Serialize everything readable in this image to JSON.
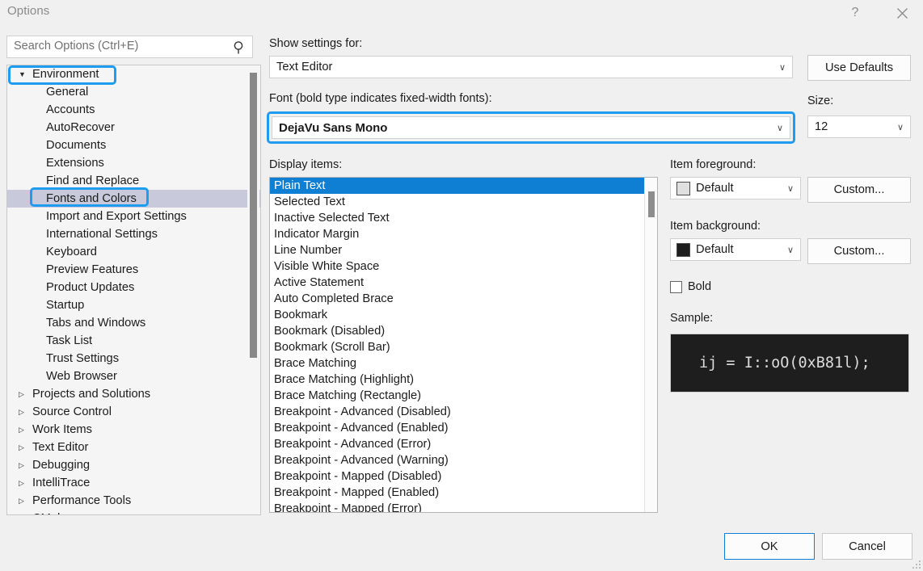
{
  "window": {
    "title": "Options",
    "help_icon": "question-mark-icon",
    "help_glyph": "?",
    "close_icon": "close-icon"
  },
  "search": {
    "placeholder": "Search Options (Ctrl+E)",
    "icon": "search-icon"
  },
  "tree": {
    "scrollbar": "vertical-scrollbar",
    "nodes": [
      {
        "label": "Environment",
        "level": 0,
        "expanded": true,
        "selected": false,
        "arrow": "▼",
        "highlighted": true
      },
      {
        "label": "General",
        "level": 1,
        "expanded": false,
        "selected": false,
        "arrow": "",
        "highlighted": false
      },
      {
        "label": "Accounts",
        "level": 1,
        "expanded": false,
        "selected": false,
        "arrow": "",
        "highlighted": false
      },
      {
        "label": "AutoRecover",
        "level": 1,
        "expanded": false,
        "selected": false,
        "arrow": "",
        "highlighted": false
      },
      {
        "label": "Documents",
        "level": 1,
        "expanded": false,
        "selected": false,
        "arrow": "",
        "highlighted": false
      },
      {
        "label": "Extensions",
        "level": 1,
        "expanded": false,
        "selected": false,
        "arrow": "",
        "highlighted": false
      },
      {
        "label": "Find and Replace",
        "level": 1,
        "expanded": false,
        "selected": false,
        "arrow": "",
        "highlighted": false
      },
      {
        "label": "Fonts and Colors",
        "level": 1,
        "expanded": false,
        "selected": true,
        "arrow": "",
        "highlighted": true
      },
      {
        "label": "Import and Export Settings",
        "level": 1,
        "expanded": false,
        "selected": false,
        "arrow": "",
        "highlighted": false
      },
      {
        "label": "International Settings",
        "level": 1,
        "expanded": false,
        "selected": false,
        "arrow": "",
        "highlighted": false
      },
      {
        "label": "Keyboard",
        "level": 1,
        "expanded": false,
        "selected": false,
        "arrow": "",
        "highlighted": false
      },
      {
        "label": "Preview Features",
        "level": 1,
        "expanded": false,
        "selected": false,
        "arrow": "",
        "highlighted": false
      },
      {
        "label": "Product Updates",
        "level": 1,
        "expanded": false,
        "selected": false,
        "arrow": "",
        "highlighted": false
      },
      {
        "label": "Startup",
        "level": 1,
        "expanded": false,
        "selected": false,
        "arrow": "",
        "highlighted": false
      },
      {
        "label": "Tabs and Windows",
        "level": 1,
        "expanded": false,
        "selected": false,
        "arrow": "",
        "highlighted": false
      },
      {
        "label": "Task List",
        "level": 1,
        "expanded": false,
        "selected": false,
        "arrow": "",
        "highlighted": false
      },
      {
        "label": "Trust Settings",
        "level": 1,
        "expanded": false,
        "selected": false,
        "arrow": "",
        "highlighted": false
      },
      {
        "label": "Web Browser",
        "level": 1,
        "expanded": false,
        "selected": false,
        "arrow": "",
        "highlighted": false
      },
      {
        "label": "Projects and Solutions",
        "level": 0,
        "expanded": false,
        "selected": false,
        "arrow": "▷",
        "highlighted": false
      },
      {
        "label": "Source Control",
        "level": 0,
        "expanded": false,
        "selected": false,
        "arrow": "▷",
        "highlighted": false
      },
      {
        "label": "Work Items",
        "level": 0,
        "expanded": false,
        "selected": false,
        "arrow": "▷",
        "highlighted": false
      },
      {
        "label": "Text Editor",
        "level": 0,
        "expanded": false,
        "selected": false,
        "arrow": "▷",
        "highlighted": false
      },
      {
        "label": "Debugging",
        "level": 0,
        "expanded": false,
        "selected": false,
        "arrow": "▷",
        "highlighted": false
      },
      {
        "label": "IntelliTrace",
        "level": 0,
        "expanded": false,
        "selected": false,
        "arrow": "▷",
        "highlighted": false
      },
      {
        "label": "Performance Tools",
        "level": 0,
        "expanded": false,
        "selected": false,
        "arrow": "▷",
        "highlighted": false
      },
      {
        "label": "CMake",
        "level": 0,
        "expanded": false,
        "selected": false,
        "arrow": "▷",
        "highlighted": false
      }
    ]
  },
  "main": {
    "show_settings_for": {
      "label": "Show settings for:",
      "value": "Text Editor",
      "chevron": "∨"
    },
    "use_defaults_label": "Use Defaults",
    "font": {
      "label": "Font (bold type indicates fixed-width fonts):",
      "value": "DejaVu Sans Mono",
      "chevron": "∨"
    },
    "size": {
      "label": "Size:",
      "value": "12",
      "chevron": "∨"
    },
    "display_items": {
      "label": "Display items:",
      "selected": "Plain Text",
      "items": [
        "Plain Text",
        "Selected Text",
        "Inactive Selected Text",
        "Indicator Margin",
        "Line Number",
        "Visible White Space",
        "Active Statement",
        "Auto Completed Brace",
        "Bookmark",
        "Bookmark (Disabled)",
        "Bookmark (Scroll Bar)",
        "Brace Matching",
        "Brace Matching (Highlight)",
        "Brace Matching (Rectangle)",
        "Breakpoint - Advanced (Disabled)",
        "Breakpoint - Advanced (Enabled)",
        "Breakpoint - Advanced (Error)",
        "Breakpoint - Advanced (Warning)",
        "Breakpoint - Mapped (Disabled)",
        "Breakpoint - Mapped (Enabled)",
        "Breakpoint - Mapped (Error)"
      ]
    },
    "item_foreground": {
      "label": "Item foreground:",
      "value": "Default",
      "swatch_color": "#e0e0e0",
      "chevron": "∨",
      "custom_label": "Custom..."
    },
    "item_background": {
      "label": "Item background:",
      "value": "Default",
      "swatch_color": "#1e1e1e",
      "chevron": "∨",
      "custom_label": "Custom..."
    },
    "bold": {
      "label": "Bold",
      "checked": false
    },
    "sample": {
      "label": "Sample:",
      "text": "ij = I::oO(0xB81l);",
      "background_color": "#1e1e1e",
      "foreground_color": "#dcdcdc"
    }
  },
  "footer": {
    "ok_label": "OK",
    "cancel_label": "Cancel",
    "resize_grip": "resize-grip-icon"
  },
  "colors": {
    "annotation_ring": "#1f9bf0",
    "list_selection": "#0f7fd4",
    "tree_selection": "#c8cadb",
    "dialog_background": "#f0f0f0"
  }
}
